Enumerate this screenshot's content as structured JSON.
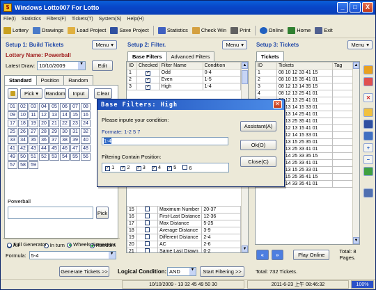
{
  "window": {
    "title": "Windows Lotto007 For Lotto",
    "minimize": "_",
    "maximize": "□",
    "close": "X"
  },
  "menu": [
    "File(I)",
    "Statistics",
    "Filters(F)",
    "Tickets(T)",
    "System(S)",
    "Help(H)"
  ],
  "toolbar": [
    {
      "label": "Lottery",
      "color": "#c8a020"
    },
    {
      "label": "Drawings",
      "color": "#4a7ac8"
    },
    {
      "label": "Load Project",
      "color": "#e0b040"
    },
    {
      "label": "Save Project",
      "color": "#3050a0"
    },
    {
      "label": "Statistics",
      "color": "#4060c0"
    },
    {
      "label": "Check Win",
      "color": "#d4a040"
    },
    {
      "label": "Print",
      "color": "#606060"
    },
    {
      "label": "Online",
      "color": "#2060c0"
    },
    {
      "label": "Home",
      "color": "#308030"
    },
    {
      "label": "Exit",
      "color": "#506090"
    }
  ],
  "setup1": {
    "title": "Setup 1: Build  Tickets",
    "menu": "Menu",
    "lottery_label": "Lottery  Name:",
    "lottery_name": "Powerball",
    "latest_draw_label": "Latest Draw:",
    "latest_draw": "10/10/2009",
    "edit": "Edit",
    "tabs": [
      "Standard",
      "Position",
      "Random"
    ],
    "pick": "Pick",
    "random": "Random",
    "input": "Input",
    "clear": "Clear",
    "numbers": [
      "01",
      "02",
      "03",
      "04",
      "05",
      "06",
      "07",
      "08",
      "09",
      "10",
      "11",
      "12",
      "13",
      "14",
      "15",
      "16",
      "17",
      "18",
      "19",
      "20",
      "21",
      "22",
      "23",
      "24",
      "25",
      "26",
      "27",
      "28",
      "29",
      "30",
      "31",
      "32",
      "33",
      "34",
      "35",
      "36",
      "37",
      "38",
      "39",
      "40",
      "41",
      "42",
      "43",
      "44",
      "45",
      "46",
      "47",
      "48",
      "49",
      "50",
      "51",
      "52",
      "53",
      "54",
      "55",
      "56",
      "57",
      "58",
      "59"
    ],
    "powerball_label": "Powerball",
    "pick2": "Pick",
    "radios": [
      "All",
      "In turn",
      "Random"
    ],
    "radios2": [
      "Full Generator",
      "Wheels Generator"
    ],
    "formula_label": "Formula:",
    "formula": "5-4"
  },
  "setup2": {
    "title": "Setup 2: Filter.",
    "menu": "Menu",
    "tabs": [
      "Base Filters",
      "Advanced Filters"
    ],
    "headers": [
      "ID",
      "Checked",
      "Filter Name",
      "Condition"
    ],
    "rows_top": [
      {
        "id": "1",
        "checked": "✓",
        "name": "Odd",
        "cond": "0-4"
      },
      {
        "id": "2",
        "checked": "✓",
        "name": "Even",
        "cond": "1-5"
      },
      {
        "id": "3",
        "checked": "✓",
        "name": "High",
        "cond": "1-4"
      }
    ],
    "rows_bottom": [
      {
        "id": "15",
        "checked": "",
        "name": "Maximum Number",
        "cond": "20-37"
      },
      {
        "id": "16",
        "checked": "",
        "name": "First-Last Distance",
        "cond": "12-36"
      },
      {
        "id": "17",
        "checked": "",
        "name": "Max Distance",
        "cond": "5-25"
      },
      {
        "id": "18",
        "checked": "",
        "name": "Average Distance",
        "cond": "3-9"
      },
      {
        "id": "19",
        "checked": "",
        "name": "Different Distance",
        "cond": "2-4"
      },
      {
        "id": "20",
        "checked": "",
        "name": "AC",
        "cond": "2-6"
      },
      {
        "id": "21",
        "checked": "",
        "name": "Same Last Drawn",
        "cond": "0-2"
      }
    ]
  },
  "setup3": {
    "title": "Setup 3: Tickets",
    "menu": "Menu",
    "tab": "Tickets",
    "headers": [
      "ID",
      "Tickets",
      "Tag"
    ],
    "rows": [
      {
        "id": "1",
        "t": "08 10 12 33 41 15"
      },
      {
        "id": "2",
        "t": "08 10 15 35 41 01"
      },
      {
        "id": "3",
        "t": "08 12 13 14 35 15"
      },
      {
        "id": "4",
        "t": "08 12 13 25 41 01"
      },
      {
        "id": "5",
        "t": "08 12 13 25 41 01"
      },
      {
        "id": "6",
        "t": "08 13 14 15 33 01"
      },
      {
        "id": "7",
        "t": "08 13 14 25 41 01"
      },
      {
        "id": "8",
        "t": "08 13 25 35 41 01"
      },
      {
        "id": "9",
        "t": "10 12 13 15 41 01"
      },
      {
        "id": "10",
        "t": "10 12 14 15 33 01"
      },
      {
        "id": "11",
        "t": "10 13 15 25 35 01"
      },
      {
        "id": "12",
        "t": "10 13 25 33 41 01"
      },
      {
        "id": "13",
        "t": "10 14 25 33 35 15"
      },
      {
        "id": "14",
        "t": "10 14 25 33 41 01"
      },
      {
        "id": "15",
        "t": "12 13 15 25 33 01"
      },
      {
        "id": "15",
        "t": "12 15 25 35 41 15"
      },
      {
        "id": "16",
        "t": "13 14 33 35 41 01"
      }
    ],
    "play_online": "Play Online",
    "total": "Total: 8 Pages."
  },
  "dialog": {
    "title": "Base Filters: High",
    "prompt": "Please inpute your condition:",
    "formate": "Formate: 1-2 5 7",
    "value": "1-4",
    "assistant": "Assistant(A)",
    "ok": "Ok(O)",
    "close": "Close(C)",
    "position_label": "Filtering Contain Position:",
    "positions": [
      {
        "n": "1",
        "on": true
      },
      {
        "n": "2",
        "on": true
      },
      {
        "n": "3",
        "on": true
      },
      {
        "n": "4",
        "on": true
      },
      {
        "n": "5",
        "on": true
      },
      {
        "n": "6",
        "on": false
      }
    ]
  },
  "bottom": {
    "generate": "Generate Tickets >>",
    "logical_label": "Logical Condition:",
    "logical": "AND",
    "start": "Start Filtering >>",
    "total": "Total: 732 Tickets."
  },
  "status": {
    "draw": "10/10/2009 - 13 32 45 49 50 30",
    "time": "2011-6-23 上午 08:46:32",
    "zoom": "100%"
  }
}
